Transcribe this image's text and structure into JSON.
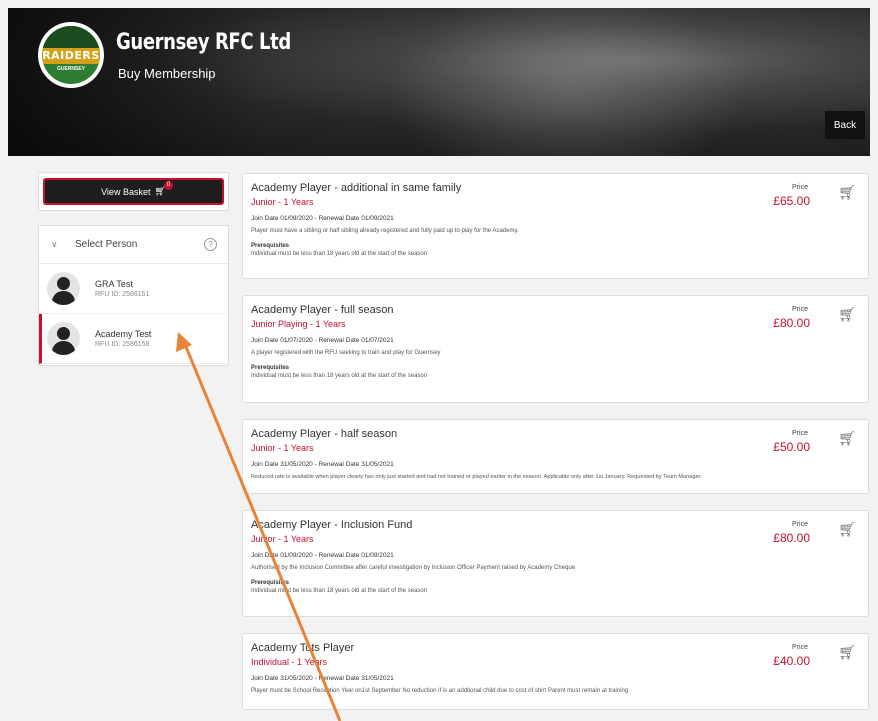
{
  "header": {
    "club_name": "Guernsey RFC Ltd",
    "subtitle": "Buy Membership",
    "logo_text": "RAIDERS",
    "logo_sub": "GUERNSEY",
    "back_label": "Back"
  },
  "basket": {
    "label": "View Basket",
    "count": "0"
  },
  "person_panel": {
    "title": "Select Person",
    "people": [
      {
        "name": "GRA Test",
        "rfu": "RFU ID: 2586151"
      },
      {
        "name": "Academy Test",
        "rfu": "RFU ID: 2586158"
      }
    ]
  },
  "price_label": "Price",
  "prereq_heading": "Prerequisites",
  "memberships": [
    {
      "title": "Academy Player - additional in same family",
      "category": "Junior - 1 Years",
      "price": "£65.00",
      "dates": "Join Date 01/09/2020 - Renewal Date 01/09/2021",
      "description": "Player must have a sibling or half sibling already registered and fully paid up to play for the Academy.",
      "prerequisite": "Individual must be less than 18 years old at the start of the season"
    },
    {
      "title": "Academy Player - full season",
      "category": "Junior Playing - 1 Years",
      "price": "£80.00",
      "dates": "Join Date 01/07/2020 - Renewal Date 01/07/2021",
      "description": "A player registered with the RFU seeking to train and play for Guernsey",
      "prerequisite": "Individual must be less than 18 years old at the start of the season"
    },
    {
      "title": "Academy Player - half season",
      "category": "Junior - 1 Years",
      "price": "£50.00",
      "dates": "Join Date 31/05/2020 - Renewal Date 31/05/2021",
      "description": "Reduced rate is available when player clearly has only just started and had not trained or played earlier in the season. Applicable only after 1st January. Requested by Team Manager.",
      "prerequisite": ""
    },
    {
      "title": "Academy Player - Inclusion Fund",
      "category": "Junior - 1 Years",
      "price": "£80.00",
      "dates": "Join Date 01/09/2020 - Renewal Date 01/09/2021",
      "description": "Authorised by the Inclusion Committee after careful investigation by Inclusion Officer Payment raised by Academy Cheque",
      "prerequisite": "Individual must be less than 18 years old at the start of the season"
    },
    {
      "title": "Academy Tots Player",
      "category": "Individual - 1 Years",
      "price": "£40.00",
      "dates": "Join Date 31/05/2020 - Renewal Date 31/05/2021",
      "description": "Player must be School Reception Year on1st September No reduction if is an addtional child due to cost of shirt Parent must remain at training",
      "prerequisite": ""
    }
  ],
  "colors": {
    "accent": "#c8102e",
    "annotation_arrow": "#e8833a"
  }
}
